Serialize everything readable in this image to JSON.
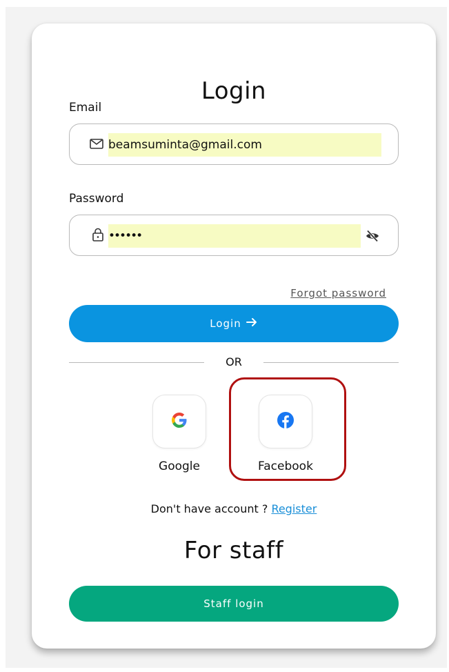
{
  "login": {
    "title": "Login",
    "email_label": "Email",
    "email_value": "beamsuminta@gmail.com",
    "password_label": "Password",
    "password_value": "••••••",
    "forgot_link": "Forgot password",
    "login_button": "Login",
    "or_text": "OR",
    "social": {
      "google_label": "Google",
      "facebook_label": "Facebook"
    },
    "register_prompt": "Don't have account ?",
    "register_link": "Register"
  },
  "staff": {
    "title": "For staff",
    "button": "Staff login"
  },
  "colors": {
    "login_button": "#0a94e0",
    "staff_button": "#05a77f",
    "autofill_highlight": "#f7fbc3",
    "highlight_box": "#b01010",
    "link": "#1a8fd8"
  },
  "icons": [
    "mail-icon",
    "lock-icon",
    "eye-off-icon",
    "arrow-right-icon",
    "google-icon",
    "facebook-icon"
  ]
}
